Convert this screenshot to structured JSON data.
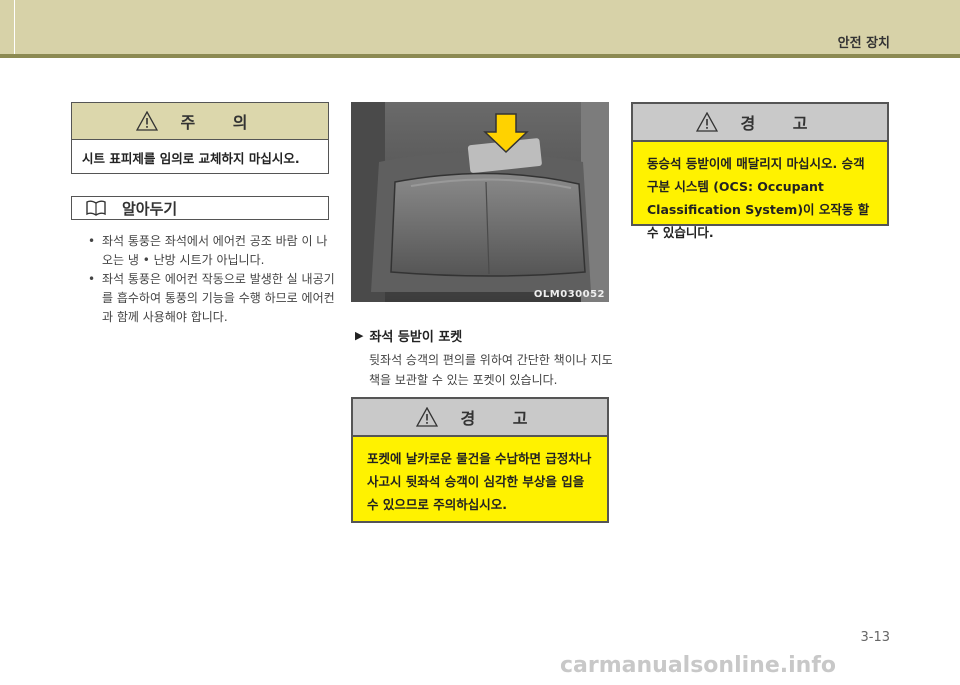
{
  "header": {
    "title": "안전 장치"
  },
  "caution": {
    "heading": "주 의",
    "text": "시트 표피제를 임의로 교체하지 마십시오."
  },
  "note": {
    "heading": "알아두기",
    "bullets": [
      "좌석 통풍은 좌석에서 에어컨 공조 바람 이 나오는 냉 • 난방 시트가 아닙니다.",
      "좌석 통풍은 에어컨 작동으로 발생한 실 내공기를 흡수하여 통풍의 기능을 수행 하므로 에어컨과 함께 사용해야 합니다."
    ]
  },
  "photo": {
    "label": "OLM030052"
  },
  "section": {
    "title": "좌석 등받이 포켓",
    "body": "뒷좌석 승객의 편의를 위하여 간단한 책이나 지도책을 보관할 수 있는 포켓이 있습니다."
  },
  "warning1": {
    "heading": "경 고",
    "text": "포켓에 날카로운 물건을 수납하면 급정차나 사고시 뒷좌석 승객이 심각한 부상을 입을 수 있으므로 주의하십시오."
  },
  "warning2": {
    "heading": "경 고",
    "text": "동승석 등받이에 매달리지 마십시오. 승객 구분 시스템 (OCS: Occupant Classification System)이 오작동 할 수 있습니다."
  },
  "page_number": "3-13",
  "watermark": "carmanualsonline.info",
  "colors": {
    "header": "#d7d2a8",
    "header_bar": "#8c8a52",
    "warning_fill": "#fff200",
    "warning_band": "#c9c9c9"
  }
}
